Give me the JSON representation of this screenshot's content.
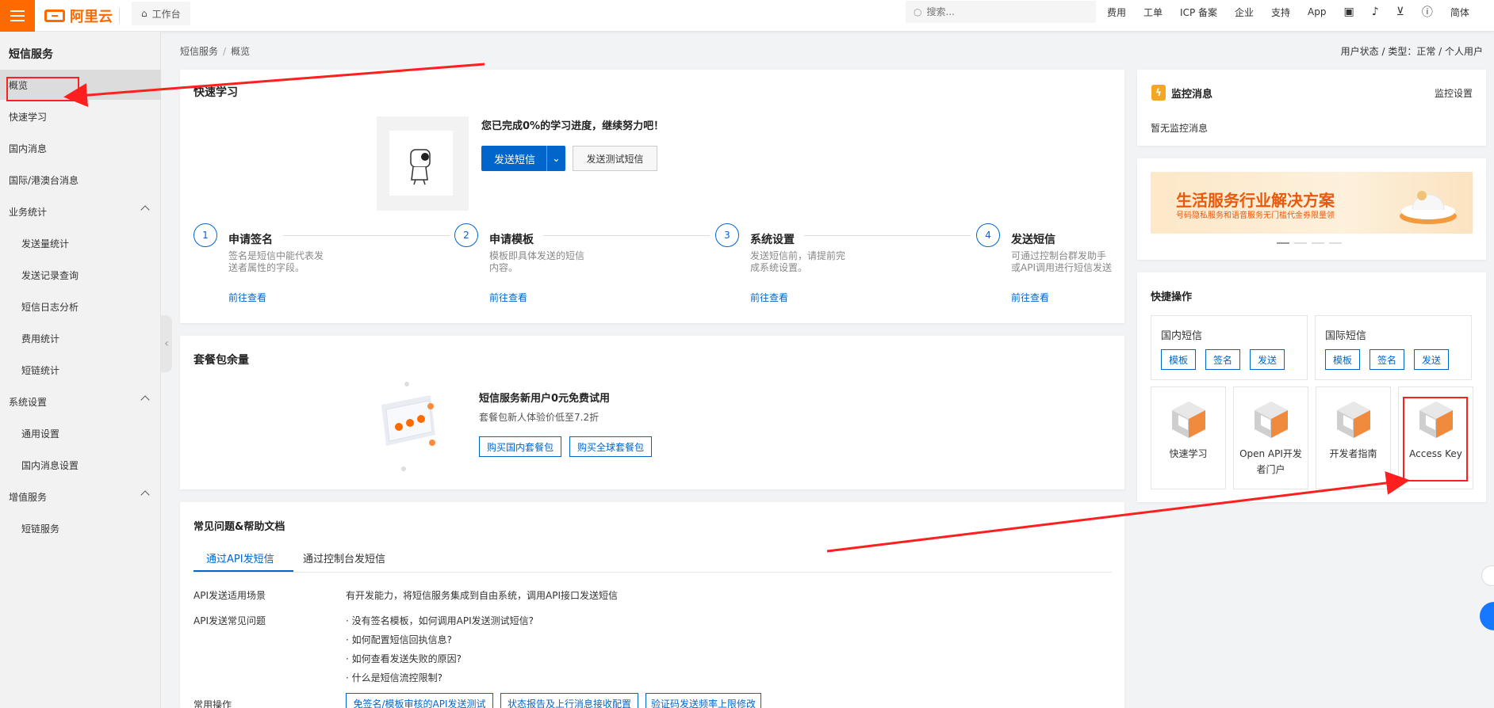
{
  "topbar": {
    "logo_text": "阿里云",
    "workbench_label": "工作台",
    "search_placeholder": "搜索...",
    "nav": [
      "费用",
      "工单",
      "ICP 备案",
      "企业",
      "支持",
      "App"
    ],
    "lang": "简体",
    "accent_color": "#ff6a00"
  },
  "sidebar": {
    "title": "短信服务",
    "items": [
      {
        "label": "概览",
        "active": true
      },
      {
        "label": "快速学习"
      },
      {
        "label": "国内消息"
      },
      {
        "label": "国际/港澳台消息"
      },
      {
        "label": "业务统计",
        "group": true
      },
      {
        "label": "发送量统计",
        "sub": true
      },
      {
        "label": "发送记录查询",
        "sub": true
      },
      {
        "label": "短信日志分析",
        "sub": true
      },
      {
        "label": "费用统计",
        "sub": true
      },
      {
        "label": "短链统计",
        "sub": true
      },
      {
        "label": "系统设置",
        "group": true
      },
      {
        "label": "通用设置",
        "sub": true
      },
      {
        "label": "国内消息设置",
        "sub": true
      },
      {
        "label": "增值服务",
        "group": true
      },
      {
        "label": "短链服务",
        "sub": true
      }
    ]
  },
  "breadcrumb": {
    "root": "短信服务",
    "sep": "/",
    "current": "概览"
  },
  "user_state": "用户状态 / 类型：正常 / 个人用户",
  "quick_learn": {
    "title": "快速学习",
    "progress_text": "您已完成0%的学习进度，继续努力吧！",
    "send_button": "发送短信",
    "test_button": "发送测试短信",
    "steps": [
      {
        "num": "1",
        "title": "申请签名",
        "desc": "签名是短信中能代表发送者属性的字段。",
        "link": "前往查看"
      },
      {
        "num": "2",
        "title": "申请模板",
        "desc": "模板即具体发送的短信内容。",
        "link": "前往查看"
      },
      {
        "num": "3",
        "title": "系统设置",
        "desc": "发送短信前，请提前完成系统设置。",
        "link": "前往查看"
      },
      {
        "num": "4",
        "title": "发送短信",
        "desc": "可通过控制台群发助手或API调用进行短信发送",
        "link": "前往查看"
      }
    ]
  },
  "package": {
    "title": "套餐包余量",
    "headline": "短信服务新用户0元免费试用",
    "sub": "套餐包新人体验价低至7.2折",
    "btn_domestic": "购买国内套餐包",
    "btn_global": "购买全球套餐包"
  },
  "faq": {
    "title": "常见问题&帮助文档",
    "tabs": [
      "通过API发短信",
      "通过控制台发短信"
    ],
    "rows": [
      {
        "label": "API发送适用场景",
        "lines": [
          "有开发能力，将短信服务集成到自由系统，调用API接口发送短信"
        ]
      },
      {
        "label": "API发送常见问题",
        "lines": [
          "· 没有签名模板，如何调用API发送测试短信?",
          "· 如何配置短信回执信息?",
          "· 如何查看发送失败的原因?",
          "· 什么是短信流控限制?"
        ]
      }
    ],
    "ops_label": "常用操作",
    "ops": [
      "免签名/模板审核的API发送测试",
      "状态报告及上行消息接收配置",
      "验证码发送频率上限修改"
    ]
  },
  "monitor": {
    "title": "监控消息",
    "settings": "监控设置",
    "empty": "暂无监控消息"
  },
  "banner": {
    "title": "生活服务行业解决方案",
    "sub": "号码隐私服务和语音服务无门槛代金券限量领"
  },
  "quick_ops": {
    "title": "快捷操作",
    "domestic": {
      "label": "国内短信",
      "buttons": [
        "模板",
        "签名",
        "发送"
      ]
    },
    "international": {
      "label": "国际短信",
      "buttons": [
        "模板",
        "签名",
        "发送"
      ]
    },
    "tiles": [
      "快速学习",
      "Open API开发者门户",
      "开发者指南",
      "Access Key"
    ]
  },
  "colors": {
    "primary": "#0066cc",
    "annotation": "#ff1f1f"
  }
}
